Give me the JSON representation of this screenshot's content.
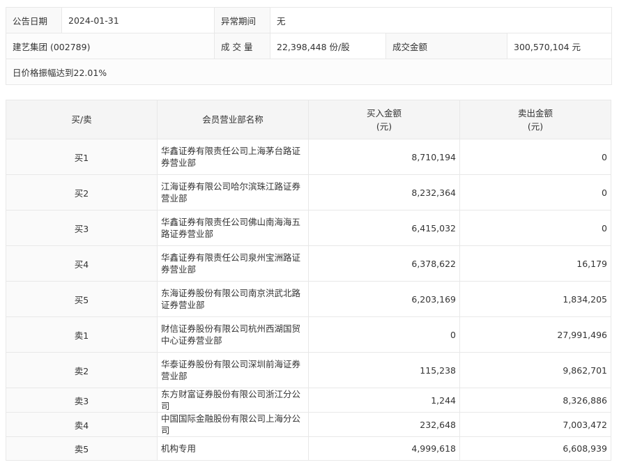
{
  "info": {
    "date_label": "公告日期",
    "date_value": "2024-01-31",
    "period_label": "异常期间",
    "period_value": "无",
    "stock": "建艺集团 (002789)",
    "volume_label": "成 交 量",
    "volume_value": "22,398,448 份/股",
    "amount_label": "成交金额",
    "amount_value": "300,570,104 元",
    "reason": "日价格振幅达到22.01%"
  },
  "table": {
    "headers": {
      "side": "买/卖",
      "name": "会员营业部名称",
      "buy": "买入金额",
      "buy_unit": "(元)",
      "sell": "卖出金额",
      "sell_unit": "(元)"
    },
    "rows": [
      {
        "side": "买1",
        "name": "华鑫证券有限责任公司上海茅台路证券营业部",
        "buy": "8,710,194",
        "sell": "0"
      },
      {
        "side": "买2",
        "name": "江海证券有限公司哈尔滨珠江路证券营业部",
        "buy": "8,232,364",
        "sell": "0"
      },
      {
        "side": "买3",
        "name": "华鑫证券有限责任公司佛山南海海五路证券营业部",
        "buy": "6,415,032",
        "sell": "0"
      },
      {
        "side": "买4",
        "name": "华鑫证券有限责任公司泉州宝洲路证券营业部",
        "buy": "6,378,622",
        "sell": "16,179"
      },
      {
        "side": "买5",
        "name": "东海证券股份有限公司南京洪武北路证券营业部",
        "buy": "6,203,169",
        "sell": "1,834,205"
      },
      {
        "side": "卖1",
        "name": "财信证券股份有限公司杭州西湖国贸中心证券营业部",
        "buy": "0",
        "sell": "27,991,496"
      },
      {
        "side": "卖2",
        "name": "华泰证券股份有限公司深圳前海证券营业部",
        "buy": "115,238",
        "sell": "9,862,701"
      },
      {
        "side": "卖3",
        "name": "东方财富证券股份有限公司浙江分公司",
        "buy": "1,244",
        "sell": "8,326,886"
      },
      {
        "side": "卖4",
        "name": "中国国际金融股份有限公司上海分公司",
        "buy": "232,648",
        "sell": "7,003,472"
      },
      {
        "side": "卖5",
        "name": "机构专用",
        "buy": "4,999,618",
        "sell": "6,608,939"
      }
    ]
  }
}
